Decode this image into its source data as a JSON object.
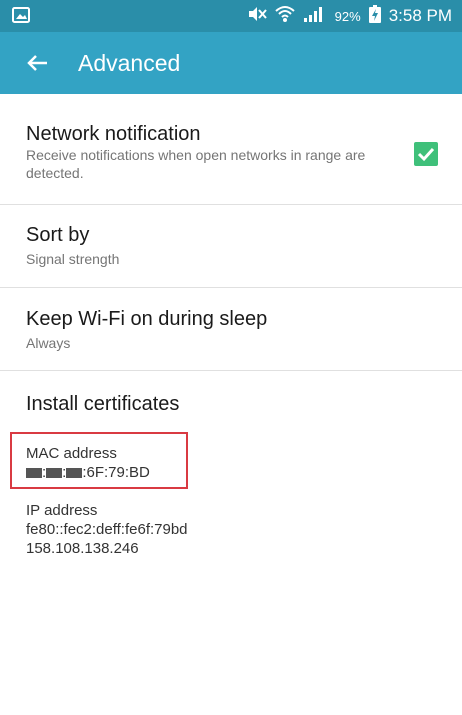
{
  "status_bar": {
    "battery_level": "92%",
    "time": "3:58 PM",
    "icons": [
      "gallery-icon",
      "mute-icon",
      "wifi-icon",
      "signal-icon",
      "battery-charging-icon"
    ],
    "background_color": "#2a8ea9"
  },
  "app_bar": {
    "title": "Advanced",
    "back_icon": "arrow-left-icon",
    "background_color": "#33a3c4"
  },
  "settings": {
    "network_notification": {
      "title": "Network notification",
      "summary": "Receive notifications when open networks in range are detected.",
      "checked": true,
      "check_color": "#3fc07a"
    },
    "sort_by": {
      "title": "Sort by",
      "value": "Signal strength"
    },
    "keep_wifi": {
      "title": "Keep Wi-Fi on during sleep",
      "value": "Always"
    },
    "install_certificates": {
      "title": "Install certificates"
    }
  },
  "info": {
    "mac": {
      "label": "MAC address",
      "separator": ":",
      "value_suffix": ":6F:79:BD"
    },
    "ip": {
      "label": "IP address",
      "ipv6": "fe80::fec2:deff:fe6f:79bd",
      "ipv4": "158.108.138.246"
    }
  },
  "annotation": {
    "highlight_color": "#d93a42"
  }
}
